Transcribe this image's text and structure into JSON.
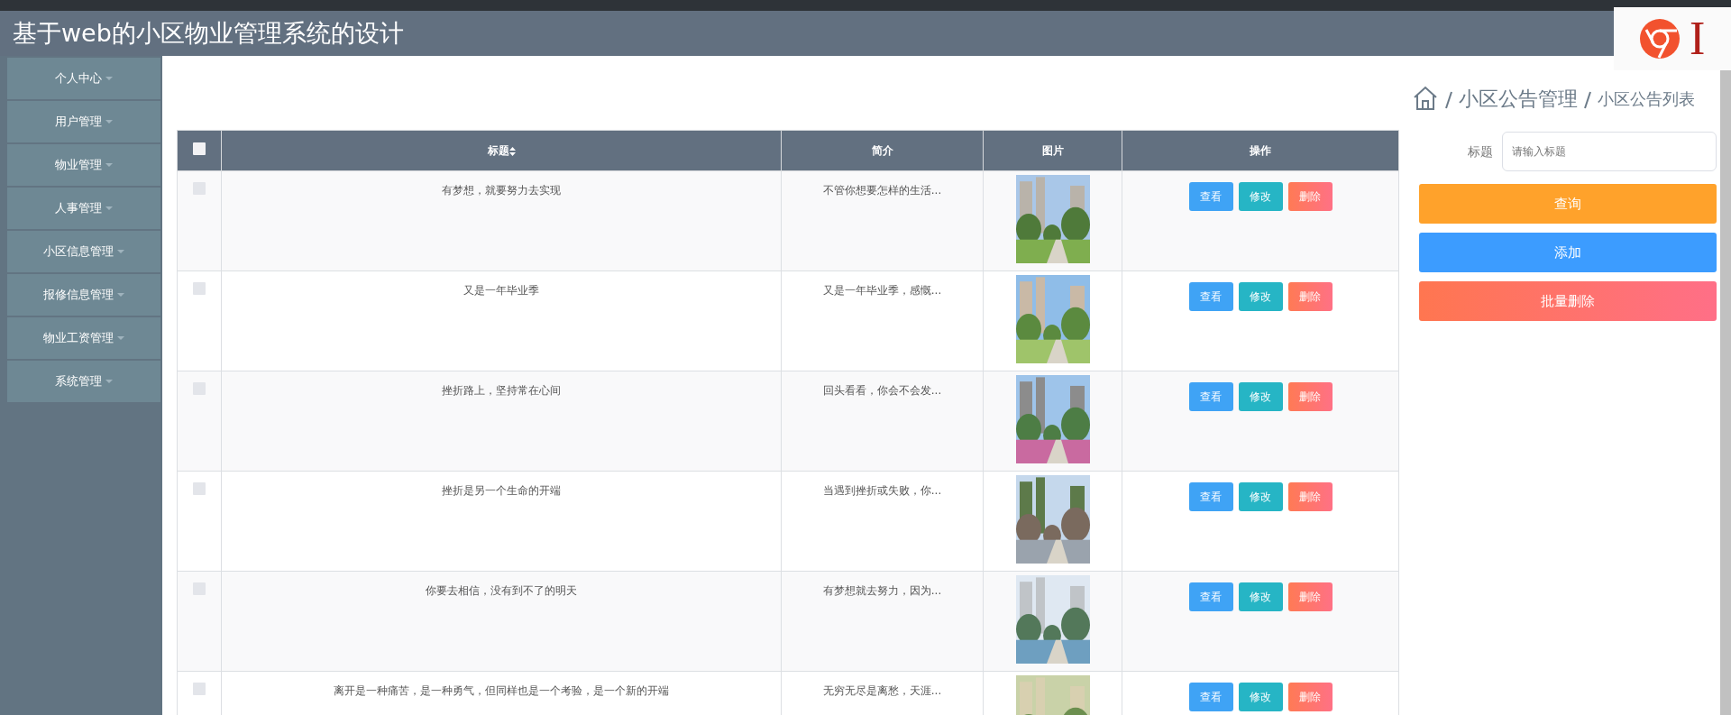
{
  "header": {
    "title": "基于web的小区物业管理系统的设计"
  },
  "corner_badge": {
    "text": "I"
  },
  "sidebar": {
    "items": [
      {
        "label": "个人中心"
      },
      {
        "label": "用户管理"
      },
      {
        "label": "物业管理"
      },
      {
        "label": "人事管理"
      },
      {
        "label": "小区信息管理"
      },
      {
        "label": "报修信息管理"
      },
      {
        "label": "物业工资管理"
      },
      {
        "label": "系统管理"
      }
    ]
  },
  "breadcrumb": {
    "items": [
      "小区公告管理",
      "小区公告列表"
    ]
  },
  "table": {
    "select_all_checked": false,
    "columns": [
      {
        "label": "标题",
        "sortable": true
      },
      {
        "label": "简介",
        "sortable": false
      },
      {
        "label": "图片",
        "sortable": false
      },
      {
        "label": "操作",
        "sortable": false
      }
    ],
    "rows": [
      {
        "checked": false,
        "title": "有梦想，就要努力去实现",
        "intro": "不管你想要怎样的生活...",
        "image": {
          "kind": "picture"
        },
        "actions": [
          {
            "label": "查看",
            "kind": "view"
          },
          {
            "label": "修改",
            "kind": "edit"
          },
          {
            "label": "删除",
            "kind": "delete"
          }
        ]
      },
      {
        "checked": false,
        "title": "又是一年毕业季",
        "intro": "又是一年毕业季，感慨...",
        "image": {
          "kind": "picture"
        },
        "actions": [
          {
            "label": "查看",
            "kind": "view"
          },
          {
            "label": "修改",
            "kind": "edit"
          },
          {
            "label": "删除",
            "kind": "delete"
          }
        ]
      },
      {
        "checked": false,
        "title": "挫折路上，坚持常在心间",
        "intro": "回头看看，你会不会发...",
        "image": {
          "kind": "picture"
        },
        "actions": [
          {
            "label": "查看",
            "kind": "view"
          },
          {
            "label": "修改",
            "kind": "edit"
          },
          {
            "label": "删除",
            "kind": "delete"
          }
        ]
      },
      {
        "checked": false,
        "title": "挫折是另一个生命的开端",
        "intro": "当遇到挫折或失败，你...",
        "image": {
          "kind": "picture"
        },
        "actions": [
          {
            "label": "查看",
            "kind": "view"
          },
          {
            "label": "修改",
            "kind": "edit"
          },
          {
            "label": "删除",
            "kind": "delete"
          }
        ]
      },
      {
        "checked": false,
        "title": "你要去相信，没有到不了的明天",
        "intro": "有梦想就去努力，因为...",
        "image": {
          "kind": "picture"
        },
        "actions": [
          {
            "label": "查看",
            "kind": "view"
          },
          {
            "label": "修改",
            "kind": "edit"
          },
          {
            "label": "删除",
            "kind": "delete"
          }
        ]
      },
      {
        "checked": false,
        "title": "离开是一种痛苦，是一种勇气，但同样也是一个考验，是一个新的开端",
        "intro": "无穷无尽是离愁，天涯...",
        "image": {
          "kind": "picture"
        },
        "actions": [
          {
            "label": "查看",
            "kind": "view"
          },
          {
            "label": "修改",
            "kind": "edit"
          },
          {
            "label": "删除",
            "kind": "delete"
          }
        ]
      }
    ]
  },
  "search": {
    "label": "标题",
    "placeholder": "请输入标题"
  },
  "buttons": [
    {
      "label": "查询",
      "kind": "search"
    },
    {
      "label": "添加",
      "kind": "add"
    },
    {
      "label": "批量删除",
      "kind": "batch-delete"
    }
  ]
}
